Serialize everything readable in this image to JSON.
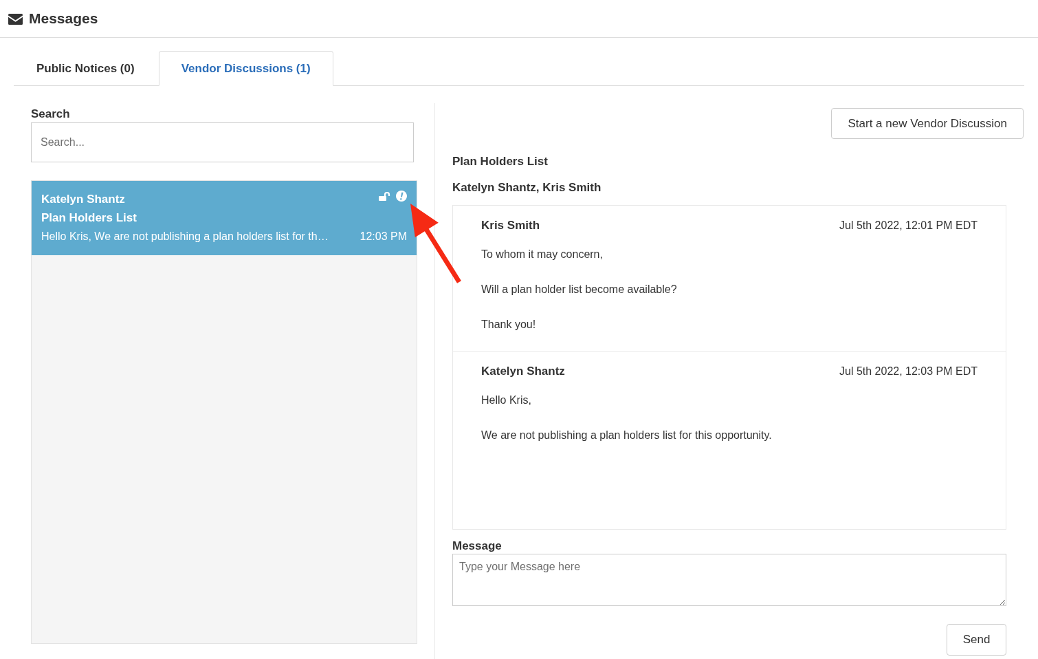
{
  "header": {
    "title": "Messages"
  },
  "tabs": [
    {
      "label": "Public Notices (0)",
      "selected": false
    },
    {
      "label": "Vendor Discussions (1)",
      "selected": true
    }
  ],
  "search": {
    "label": "Search",
    "placeholder": "Search..."
  },
  "conversations": [
    {
      "sender": "Katelyn Shantz",
      "subject": "Plan Holders List",
      "preview": "Hello Kris, We are not publishing a plan holders list for th…",
      "time": "12:03 PM",
      "selected": true,
      "locked": false,
      "alert": true
    }
  ],
  "new_discussion_button": "Start a new Vendor Discussion",
  "thread": {
    "subject": "Plan Holders List",
    "participants": "Katelyn Shantz, Kris Smith",
    "messages": [
      {
        "sender": "Kris Smith",
        "date": "Jul 5th 2022, 12:01 PM EDT",
        "paragraphs": [
          "To whom it may concern,",
          "Will a plan holder list become available?",
          "Thank you!"
        ]
      },
      {
        "sender": "Katelyn Shantz",
        "date": "Jul 5th 2022, 12:03 PM EDT",
        "paragraphs": [
          "Hello Kris,",
          "We are not publishing a plan holders list for this opportunity."
        ]
      }
    ]
  },
  "composer": {
    "label": "Message",
    "placeholder": "Type your Message here",
    "button": "Send"
  },
  "annotations": [
    {
      "kind": "arrow"
    }
  ]
}
